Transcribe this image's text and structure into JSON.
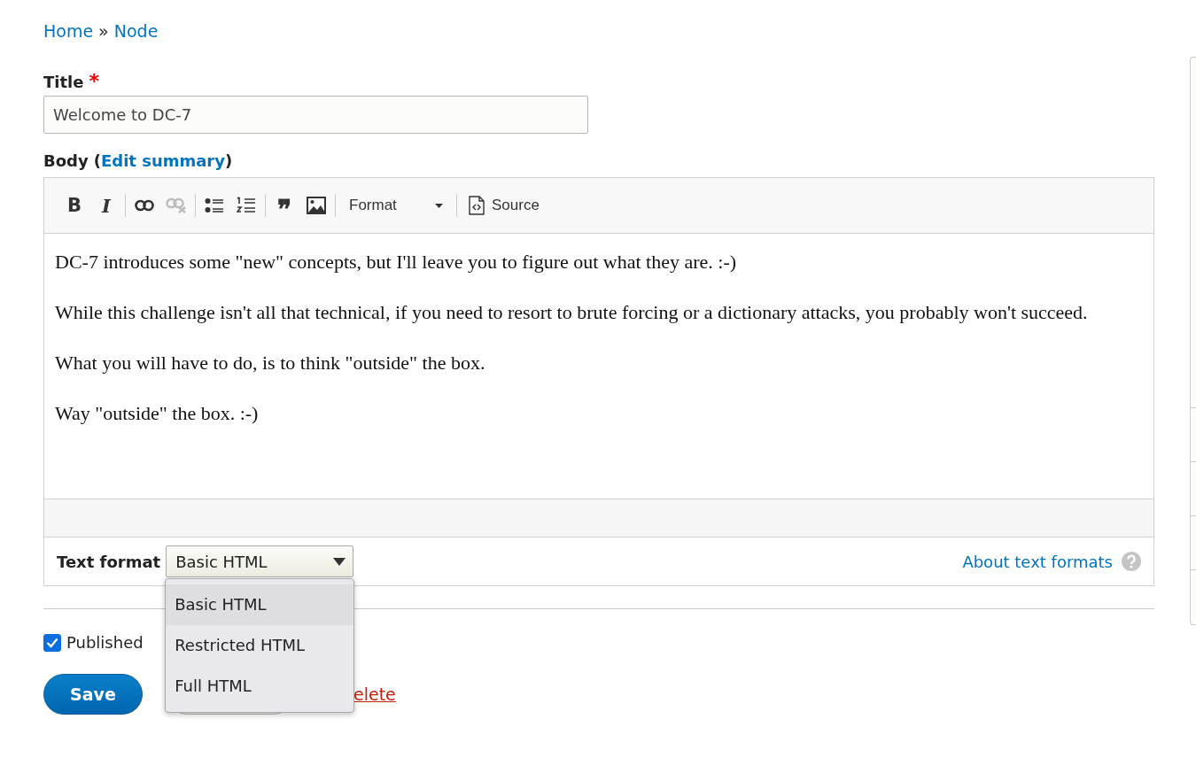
{
  "breadcrumb": [
    {
      "label": "Home"
    },
    {
      "label": "Node"
    }
  ],
  "breadcrumb_separator": "»",
  "title_field": {
    "label": "Title",
    "required_mark": "*",
    "value": "Welcome to DC-7"
  },
  "body_field": {
    "label": "Body",
    "paren_open": "(",
    "summary_link": "Edit summary",
    "paren_close": ")",
    "toolbar": [
      {
        "kind": "bold",
        "label": "B",
        "disabled": false
      },
      {
        "kind": "italic",
        "label": "I",
        "disabled": false
      },
      {
        "kind": "separator"
      },
      {
        "kind": "link",
        "disabled": false
      },
      {
        "kind": "unlink",
        "disabled": true
      },
      {
        "kind": "separator"
      },
      {
        "kind": "bullets",
        "disabled": false
      },
      {
        "kind": "numbers",
        "disabled": false
      },
      {
        "kind": "separator"
      },
      {
        "kind": "quote",
        "label": "❞",
        "disabled": false
      },
      {
        "kind": "image",
        "disabled": false
      },
      {
        "kind": "separator"
      },
      {
        "kind": "format",
        "label": "Format",
        "disabled": false
      },
      {
        "kind": "separator"
      },
      {
        "kind": "source",
        "label": "Source",
        "disabled": false
      }
    ],
    "paragraphs": [
      "DC-7 introduces some \"new\" concepts, but I'll leave you to figure out what they are.  :-)",
      "While this challenge isn't all that technical, if you need to resort to brute forcing or a dictionary attacks, you probably won't succeed.",
      "What you will have to do, is to think \"outside\" the box.",
      "Way \"outside\" the box.  :-)"
    ]
  },
  "text_format": {
    "label": "Text format",
    "value": "Basic HTML",
    "expanded": true,
    "options": [
      {
        "label": "Basic HTML",
        "selected": true
      },
      {
        "label": "Restricted HTML",
        "selected": false
      },
      {
        "label": "Full HTML",
        "selected": false
      }
    ],
    "help_link": "About text formats"
  },
  "published": {
    "label": "Published",
    "checked": true
  },
  "actions": {
    "save": "Save",
    "delete_link": "elete"
  }
}
